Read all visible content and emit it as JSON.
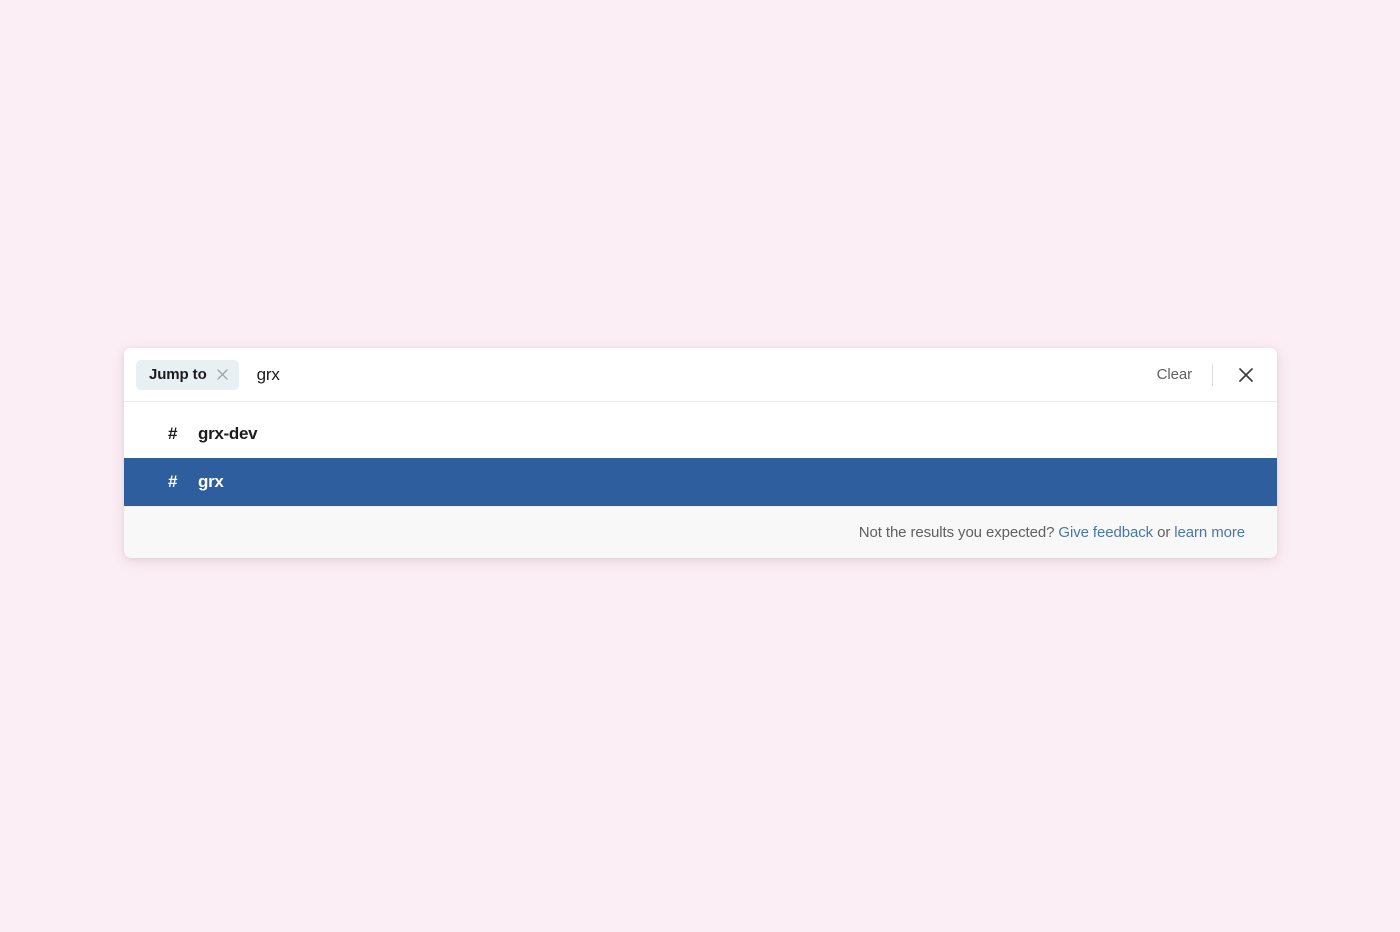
{
  "page": {
    "background_color": "#fbeef4"
  },
  "search_dialog": {
    "filter_chip": {
      "label": "Jump to",
      "remove_icon": "close-icon"
    },
    "query_text": "grx",
    "clear_label": "Clear",
    "close_icon": "close-icon",
    "results": [
      {
        "prefix": "#",
        "name": "grx-dev",
        "selected": false
      },
      {
        "prefix": "#",
        "name": "grx",
        "selected": true
      }
    ],
    "footer": {
      "prompt": "Not the results you expected?",
      "feedback_link": "Give feedback",
      "conjunction": "or",
      "learn_more_link": "learn more"
    },
    "colors": {
      "selected_row": "#2f5e9e",
      "chip_background": "#e8f0f4",
      "link": "#4a77a8",
      "footer_background": "#f8f8f8"
    }
  }
}
